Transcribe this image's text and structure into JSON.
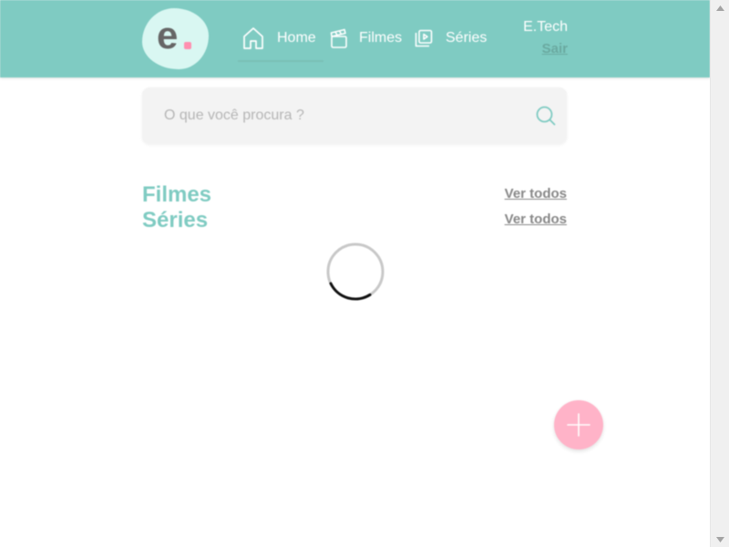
{
  "brand": {
    "logo_letter": "e",
    "accent": "#7fcbc2",
    "dot_color": "#ff8fb0"
  },
  "nav": {
    "home_label": "Home",
    "filmes_label": "Filmes",
    "series_label": "Séries",
    "icons": {
      "home": "home-icon",
      "filmes": "clapperboard-icon",
      "series": "play-stack-icon"
    }
  },
  "user": {
    "name": "E.Tech",
    "logout_label": "Sair"
  },
  "search": {
    "placeholder": "O que você procura ?",
    "value": "",
    "icon": "search-icon"
  },
  "sections": {
    "filmes_title": "Filmes",
    "series_title": "Séries",
    "see_all_label": "Ver todos"
  },
  "loading": {
    "icon": "loading-spinner"
  },
  "fab": {
    "icon": "plus-icon",
    "color": "#ffb3c8"
  },
  "colors": {
    "header": "#7fcbc2",
    "section_title": "#7fcbc2",
    "fab": "#ffb3c8"
  }
}
